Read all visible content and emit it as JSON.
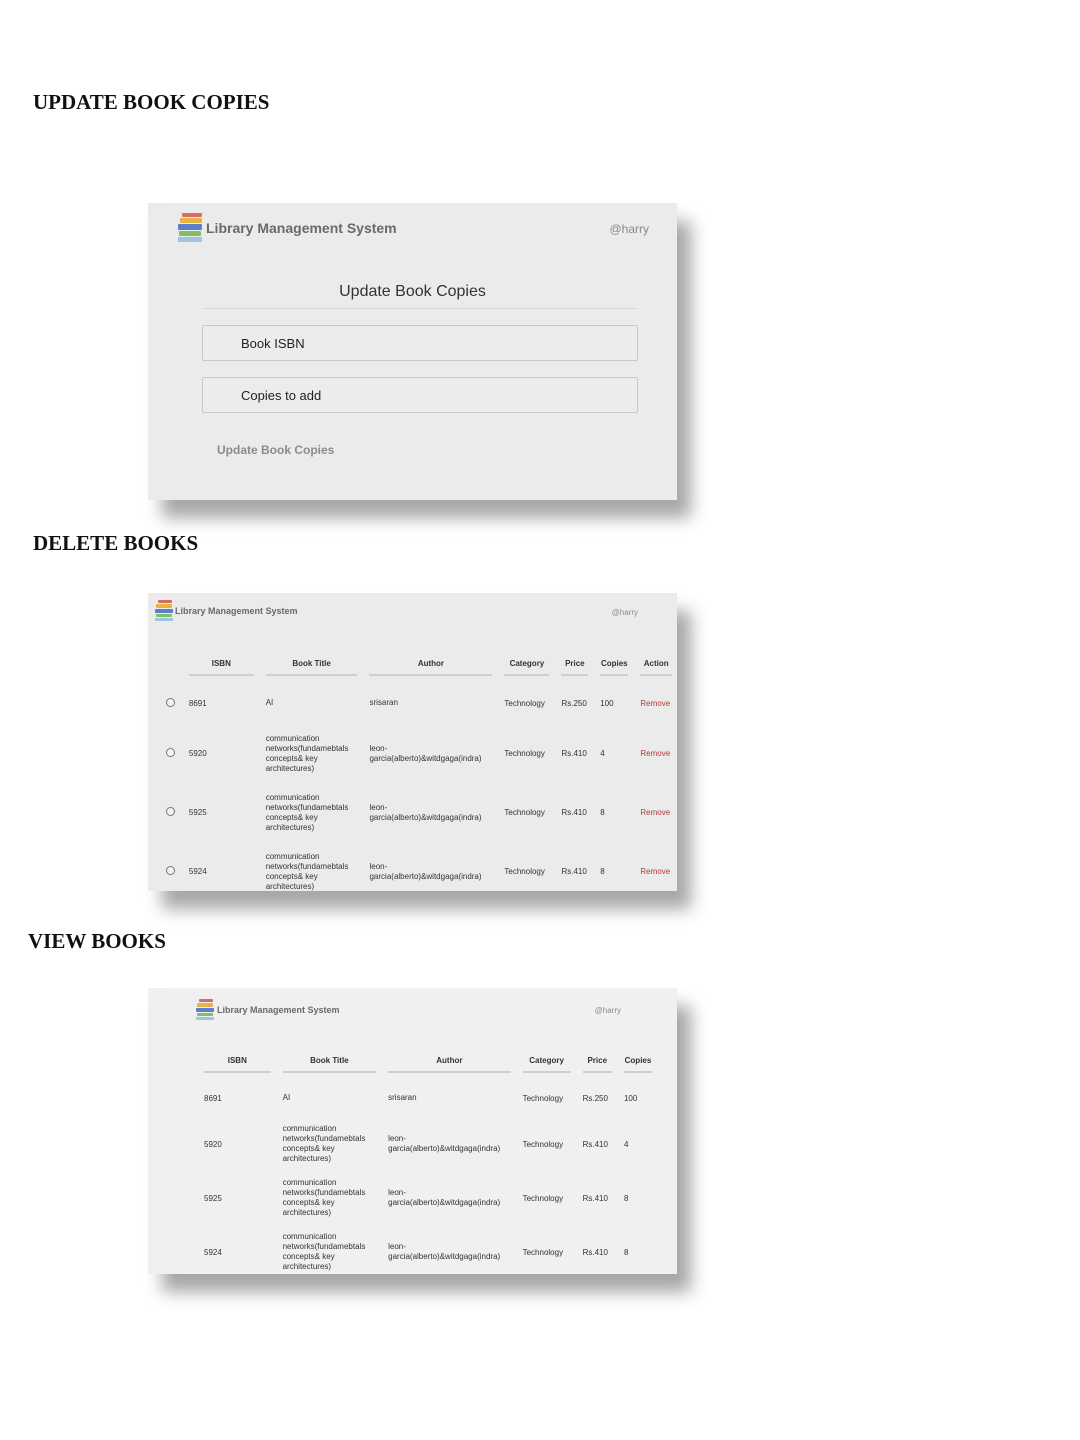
{
  "sections": {
    "update": "UPDATE BOOK COPIES",
    "delete": "DELETE BOOKS",
    "view": "VIEW BOOKS"
  },
  "app": {
    "name": "Library Management System",
    "user": "@harry"
  },
  "update_form": {
    "title": "Update Book Copies",
    "isbn_placeholder": "Book ISBN",
    "copies_placeholder": "Copies to add",
    "submit_label": "Update Book Copies"
  },
  "delete_table": {
    "headers": [
      "ISBN",
      "Book Title",
      "Author",
      "Category",
      "Price",
      "Copies",
      "Action"
    ],
    "rows": [
      {
        "isbn": "8691",
        "title": "AI",
        "author": "srisaran",
        "category": "Technology",
        "price": "Rs.250",
        "copies": "100",
        "action": "Remove"
      },
      {
        "isbn": "5920",
        "title": "communication networks(fundamebtals concepts& key architectures)",
        "author": "leon-garcia(alberto)&witdgaga(indra)",
        "category": "Technology",
        "price": "Rs.410",
        "copies": "4",
        "action": "Remove"
      },
      {
        "isbn": "5925",
        "title": "communication networks(fundamebtals concepts& key architectures)",
        "author": "leon-garcia(alberto)&witdgaga(indra)",
        "category": "Technology",
        "price": "Rs.410",
        "copies": "8",
        "action": "Remove"
      },
      {
        "isbn": "5924",
        "title": "communication networks(fundamebtals concepts& key architectures)",
        "author": "leon-garcia(alberto)&witdgaga(indra)",
        "category": "Technology",
        "price": "Rs.410",
        "copies": "8",
        "action": "Remove"
      }
    ]
  },
  "view_table": {
    "headers": [
      "ISBN",
      "Book Title",
      "Author",
      "Category",
      "Price",
      "Copies"
    ],
    "rows": [
      {
        "isbn": "8691",
        "title": "AI",
        "author": "srisaran",
        "category": "Technology",
        "price": "Rs.250",
        "copies": "100"
      },
      {
        "isbn": "5920",
        "title": "communication networks(fundamebtals concepts& key architectures)",
        "author": "leon-garcia(alberto)&witdgaga(indra)",
        "category": "Technology",
        "price": "Rs.410",
        "copies": "4"
      },
      {
        "isbn": "5925",
        "title": "communication networks(fundamebtals concepts& key architectures)",
        "author": "leon-garcia(alberto)&witdgaga(indra)",
        "category": "Technology",
        "price": "Rs.410",
        "copies": "8"
      },
      {
        "isbn": "5924",
        "title": "communication networks(fundamebtals concepts& key architectures)",
        "author": "leon-garcia(alberto)&witdgaga(indra)",
        "category": "Technology",
        "price": "Rs.410",
        "copies": "8"
      }
    ]
  },
  "colors": {
    "remove": "#b33a3a",
    "panel": "#ebebeb"
  },
  "icons": {
    "logo": "books-logo-icon",
    "radio": "radio-icon"
  }
}
